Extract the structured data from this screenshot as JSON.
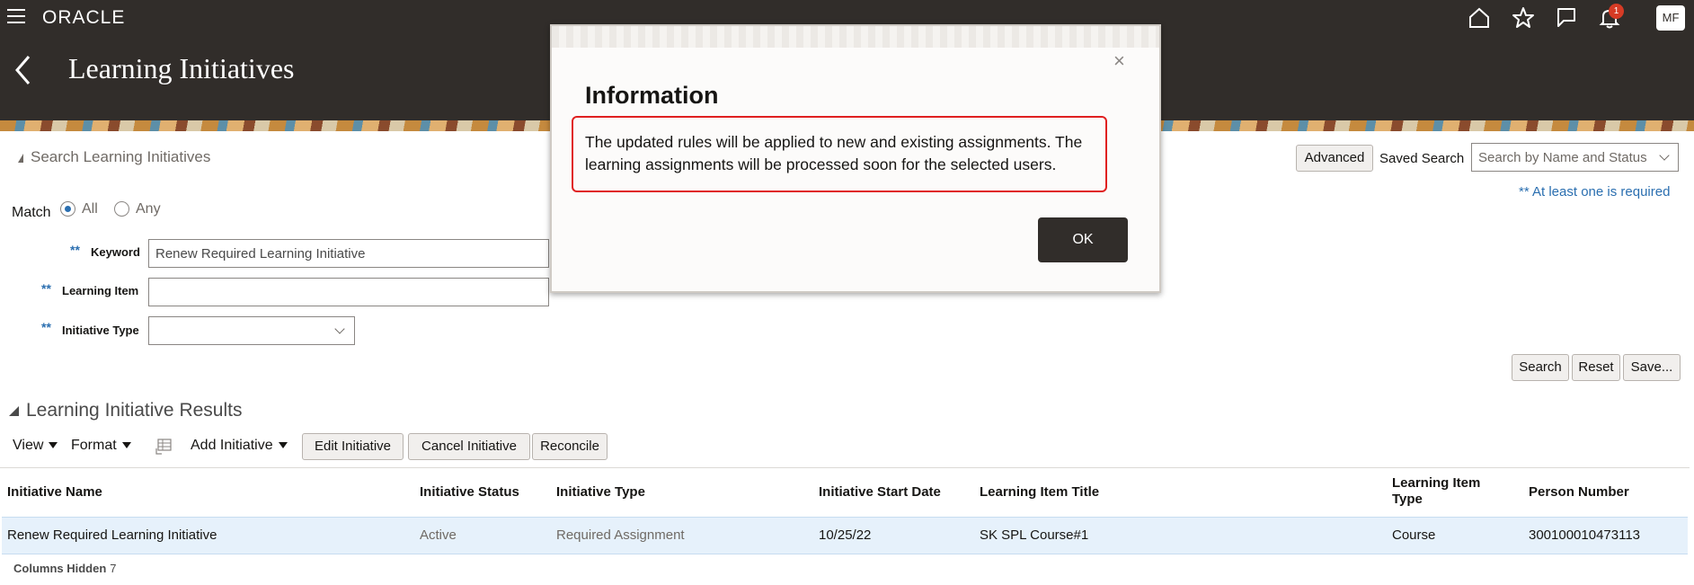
{
  "app": {
    "brand": "ORACLE",
    "notification_count": "1",
    "user_initials": "MF"
  },
  "page": {
    "title": "Learning Initiatives"
  },
  "search": {
    "header": "Search Learning Initiatives",
    "match_label": "Match",
    "match_options": [
      "All",
      "Any"
    ],
    "match_selected": "All",
    "required_marker": "**",
    "keyword_label": "Keyword",
    "keyword_value": "Renew Required Learning Initiative",
    "learning_item_label": "Learning Item",
    "learning_item_value": "",
    "initiative_type_label": "Initiative Type",
    "initiative_type_value": "",
    "advanced_label": "Advanced",
    "saved_search_label": "Saved Search",
    "saved_search_placeholder": "Search by Name and Status",
    "hint": "** At least one is required",
    "search_button": "Search",
    "reset_button": "Reset",
    "save_button": "Save..."
  },
  "results": {
    "header": "Learning Initiative Results",
    "toolbar": {
      "view": "View",
      "format": "Format",
      "add_initiative": "Add Initiative",
      "edit_initiative": "Edit Initiative",
      "cancel_initiative": "Cancel Initiative",
      "reconcile": "Reconcile"
    },
    "columns": [
      "Initiative Name",
      "Initiative Status",
      "Initiative Type",
      "Initiative Start Date",
      "Learning Item Title",
      "Learning Item Type",
      "Person Number"
    ],
    "rows": [
      [
        "Renew Required Learning Initiative",
        "Active",
        "Required Assignment",
        "10/25/22",
        "SK SPL Course#1",
        "Course",
        "300100010473113"
      ]
    ],
    "columns_hidden_label": "Columns Hidden",
    "columns_hidden_count": "7"
  },
  "dialog": {
    "title": "Information",
    "message": "The updated rules will be applied to new and existing assignments. The learning assignments will be processed soon for the selected users.",
    "ok_label": "OK",
    "highlight_color": "#e02020"
  },
  "colors": {
    "header_bg": "#312d2a",
    "accent": "#2b6fb0",
    "row_selected": "#e6f1fb",
    "badge": "#d63b25"
  },
  "icons": [
    "hamburger-icon",
    "home-icon",
    "star-icon",
    "flag-icon",
    "bell-icon",
    "back-arrow-icon",
    "column-freeze-icon",
    "close-icon",
    "chevron-down-icon"
  ]
}
